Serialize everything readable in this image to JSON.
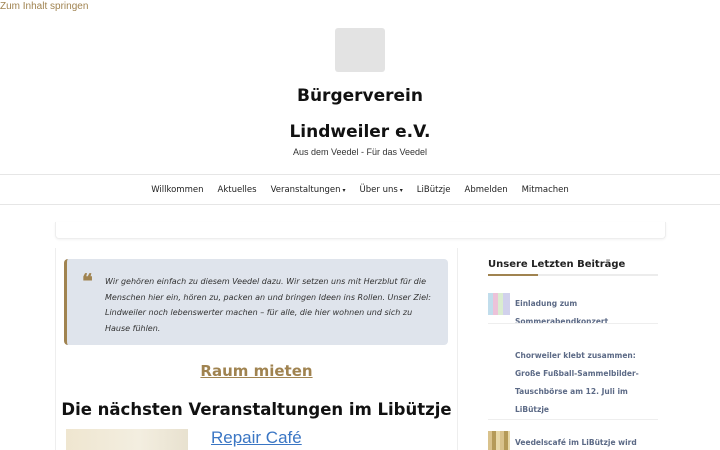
{
  "skip_link": "Zum Inhalt springen",
  "site": {
    "title_line1": "Bürgerverein",
    "title_line2": "Lindweiler e.V.",
    "tagline": "Aus dem Veedel - Für das Veedel"
  },
  "nav": {
    "items": [
      {
        "label": "Willkommen",
        "has_dropdown": false
      },
      {
        "label": "Aktuelles",
        "has_dropdown": false
      },
      {
        "label": "Veranstaltungen",
        "has_dropdown": true
      },
      {
        "label": "Über uns",
        "has_dropdown": true
      },
      {
        "label": "LiBützje",
        "has_dropdown": false
      },
      {
        "label": "Abmelden",
        "has_dropdown": false
      },
      {
        "label": "Mitmachen",
        "has_dropdown": false
      }
    ],
    "caret": "▾"
  },
  "quote": {
    "icon": "quote-icon",
    "mark": "❝",
    "text": "Wir gehören einfach zu diesem Veedel dazu. Wir setzen uns mit Herzblut für die Menschen hier ein, hören zu, packen an und bringen Ideen ins Rollen. Unser Ziel: Lindweiler noch lebenswerter machen – für alle, die hier wohnen und sich zu Hause fühlen."
  },
  "main": {
    "raum_link": "Raum mieten",
    "events_heading": "Die nächsten Veranstaltungen im Libützje",
    "event_title": "Repair Café"
  },
  "sidebar": {
    "heading": "Unsere Letzten Beiträge",
    "posts": [
      {
        "title": "Einladung zum Sommerabendkonzert"
      },
      {
        "title": "Chorweiler klebt zusammen: Große Fußball-Sammelbilder-Tauschbörse am 12. Juli im LiBützje"
      },
      {
        "title": "Veedelscafé im LiBützje wird zum"
      }
    ]
  },
  "colors": {
    "accent": "#a08350",
    "link_blue": "#3a76c4",
    "quote_bg": "#dfe4ec",
    "sidebar_link": "#5c6a86"
  }
}
